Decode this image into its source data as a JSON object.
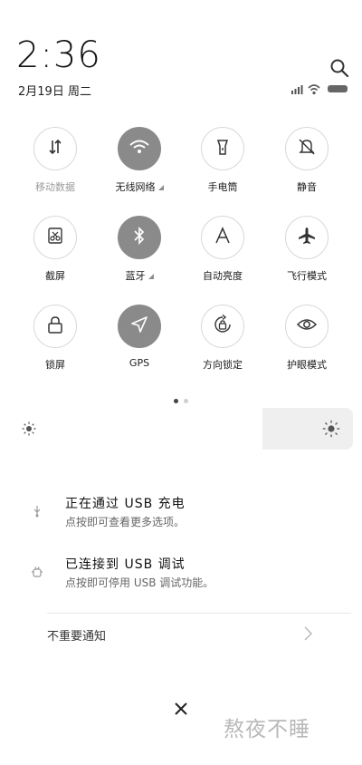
{
  "header": {
    "time": "2:36",
    "date": "2月19日 周二"
  },
  "toggles": [
    {
      "label": "移动数据",
      "icon": "mobile-data-icon",
      "active": false,
      "muted": true,
      "has_indicator": false
    },
    {
      "label": "无线网络",
      "icon": "wifi-icon",
      "active": true,
      "muted": false,
      "has_indicator": true
    },
    {
      "label": "手电筒",
      "icon": "flashlight-icon",
      "active": false,
      "muted": false,
      "has_indicator": false
    },
    {
      "label": "静音",
      "icon": "mute-icon",
      "active": false,
      "muted": false,
      "has_indicator": false
    },
    {
      "label": "截屏",
      "icon": "screenshot-icon",
      "active": false,
      "muted": false,
      "has_indicator": false
    },
    {
      "label": "蓝牙",
      "icon": "bluetooth-icon",
      "active": true,
      "muted": false,
      "has_indicator": true
    },
    {
      "label": "自动亮度",
      "icon": "auto-brightness-icon",
      "active": false,
      "muted": false,
      "has_indicator": false
    },
    {
      "label": "飞行模式",
      "icon": "airplane-icon",
      "active": false,
      "muted": false,
      "has_indicator": false
    },
    {
      "label": "锁屏",
      "icon": "lock-icon",
      "active": false,
      "muted": false,
      "has_indicator": false
    },
    {
      "label": "GPS",
      "icon": "gps-icon",
      "active": true,
      "muted": false,
      "has_indicator": false
    },
    {
      "label": "方向锁定",
      "icon": "rotation-lock-icon",
      "active": false,
      "muted": false,
      "has_indicator": false
    },
    {
      "label": "护眼模式",
      "icon": "eye-icon",
      "active": false,
      "muted": false,
      "has_indicator": false
    }
  ],
  "pagination": {
    "current_page": 1,
    "total_pages": 2
  },
  "brightness": {
    "level": 0.74
  },
  "notifications": [
    {
      "title": "正在通过 USB 充电",
      "subtitle": "点按即可查看更多选项。",
      "icon": "usb-charging-icon"
    },
    {
      "title": "已连接到 USB 调试",
      "subtitle": "点按即可停用 USB 调试功能。",
      "icon": "android-debug-icon"
    }
  ],
  "unimportant_notifications": {
    "label": "不重要通知"
  },
  "watermark": {
    "text": "熬夜不睡"
  }
}
